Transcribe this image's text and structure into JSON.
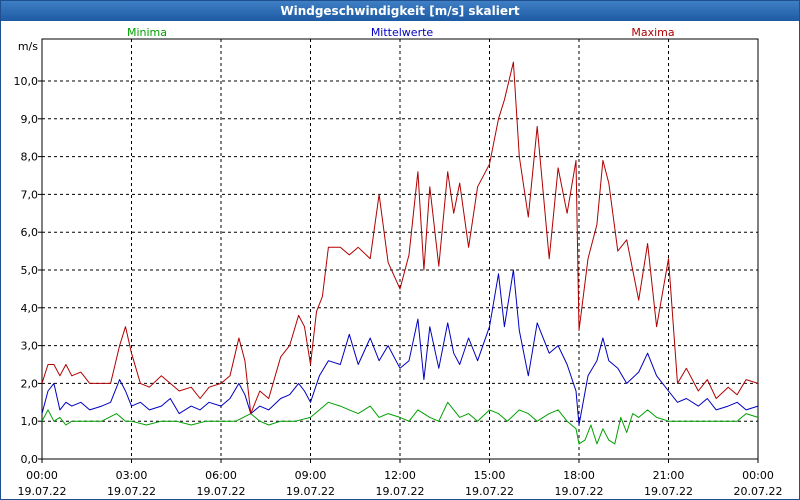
{
  "window": {
    "title": "Windgeschwindigkeit [m/s] skaliert"
  },
  "colors": {
    "min": "#00a000",
    "mean": "#0000c0",
    "max": "#b00000",
    "grid": "#000000"
  },
  "chart_data": {
    "type": "line",
    "title": "Windgeschwindigkeit [m/s] skaliert",
    "ylabel": "m/s",
    "ylim": [
      0,
      11
    ],
    "yticks": [
      0.0,
      1.0,
      2.0,
      3.0,
      4.0,
      5.0,
      6.0,
      7.0,
      8.0,
      9.0,
      10.0
    ],
    "yticklabels": [
      "0,0",
      "1,0",
      "2,0",
      "3,0",
      "4,0",
      "5,0",
      "6,0",
      "7,0",
      "8,0",
      "9,0",
      "10,0"
    ],
    "xlim": [
      0,
      24
    ],
    "xticks": [
      {
        "h": 0,
        "time": "00:00",
        "date": "19.07.22"
      },
      {
        "h": 3,
        "time": "03:00",
        "date": "19.07.22"
      },
      {
        "h": 6,
        "time": "06:00",
        "date": "19.07.22"
      },
      {
        "h": 9,
        "time": "09:00",
        "date": "19.07.22"
      },
      {
        "h": 12,
        "time": "12:00",
        "date": "19.07.22"
      },
      {
        "h": 15,
        "time": "15:00",
        "date": "19.07.22"
      },
      {
        "h": 18,
        "time": "18:00",
        "date": "19.07.22"
      },
      {
        "h": 21,
        "time": "21:00",
        "date": "19.07.22"
      },
      {
        "h": 24,
        "time": "00:00",
        "date": "20.07.22"
      }
    ],
    "grid": true,
    "series": [
      {
        "name": "Minima",
        "key": "min",
        "points": [
          [
            0,
            1.0
          ],
          [
            0.2,
            1.3
          ],
          [
            0.4,
            1.0
          ],
          [
            0.6,
            1.1
          ],
          [
            0.8,
            0.9
          ],
          [
            1.0,
            1.0
          ],
          [
            1.5,
            1.0
          ],
          [
            2.0,
            1.0
          ],
          [
            2.5,
            1.2
          ],
          [
            2.8,
            1.0
          ],
          [
            3.0,
            1.0
          ],
          [
            3.5,
            0.9
          ],
          [
            4.0,
            1.0
          ],
          [
            4.5,
            1.0
          ],
          [
            5.0,
            0.9
          ],
          [
            5.5,
            1.0
          ],
          [
            6.0,
            1.0
          ],
          [
            6.5,
            1.0
          ],
          [
            7.0,
            1.2
          ],
          [
            7.3,
            1.0
          ],
          [
            7.6,
            0.9
          ],
          [
            8.0,
            1.0
          ],
          [
            8.5,
            1.0
          ],
          [
            9.0,
            1.1
          ],
          [
            9.3,
            1.3
          ],
          [
            9.6,
            1.5
          ],
          [
            10.0,
            1.4
          ],
          [
            10.3,
            1.3
          ],
          [
            10.6,
            1.2
          ],
          [
            11.0,
            1.4
          ],
          [
            11.3,
            1.1
          ],
          [
            11.6,
            1.2
          ],
          [
            12.0,
            1.1
          ],
          [
            12.3,
            1.0
          ],
          [
            12.6,
            1.3
          ],
          [
            13.0,
            1.1
          ],
          [
            13.3,
            1.0
          ],
          [
            13.6,
            1.5
          ],
          [
            14.0,
            1.1
          ],
          [
            14.3,
            1.2
          ],
          [
            14.6,
            1.0
          ],
          [
            15.0,
            1.3
          ],
          [
            15.3,
            1.2
          ],
          [
            15.6,
            1.0
          ],
          [
            16.0,
            1.3
          ],
          [
            16.3,
            1.2
          ],
          [
            16.6,
            1.0
          ],
          [
            17.0,
            1.2
          ],
          [
            17.3,
            1.3
          ],
          [
            17.6,
            1.0
          ],
          [
            17.9,
            0.8
          ],
          [
            18.0,
            0.4
          ],
          [
            18.2,
            0.5
          ],
          [
            18.4,
            0.9
          ],
          [
            18.6,
            0.4
          ],
          [
            18.8,
            0.8
          ],
          [
            19.0,
            0.5
          ],
          [
            19.2,
            0.4
          ],
          [
            19.4,
            1.1
          ],
          [
            19.6,
            0.7
          ],
          [
            19.8,
            1.2
          ],
          [
            20.0,
            1.1
          ],
          [
            20.3,
            1.3
          ],
          [
            20.6,
            1.1
          ],
          [
            21.0,
            1.0
          ],
          [
            21.5,
            1.0
          ],
          [
            22.0,
            1.0
          ],
          [
            22.5,
            1.0
          ],
          [
            23.0,
            1.0
          ],
          [
            23.3,
            1.0
          ],
          [
            23.6,
            1.2
          ],
          [
            24.0,
            1.1
          ]
        ]
      },
      {
        "name": "Mittelwerte",
        "key": "mean",
        "points": [
          [
            0,
            1.2
          ],
          [
            0.2,
            1.8
          ],
          [
            0.4,
            2.0
          ],
          [
            0.6,
            1.3
          ],
          [
            0.8,
            1.5
          ],
          [
            1.0,
            1.4
          ],
          [
            1.3,
            1.5
          ],
          [
            1.6,
            1.3
          ],
          [
            2.0,
            1.4
          ],
          [
            2.3,
            1.5
          ],
          [
            2.6,
            2.1
          ],
          [
            2.8,
            1.8
          ],
          [
            3.0,
            1.4
          ],
          [
            3.3,
            1.5
          ],
          [
            3.6,
            1.3
          ],
          [
            4.0,
            1.4
          ],
          [
            4.3,
            1.6
          ],
          [
            4.6,
            1.2
          ],
          [
            5.0,
            1.4
          ],
          [
            5.3,
            1.3
          ],
          [
            5.6,
            1.5
          ],
          [
            6.0,
            1.4
          ],
          [
            6.3,
            1.6
          ],
          [
            6.6,
            2.0
          ],
          [
            6.8,
            1.7
          ],
          [
            7.0,
            1.2
          ],
          [
            7.3,
            1.4
          ],
          [
            7.6,
            1.3
          ],
          [
            8.0,
            1.6
          ],
          [
            8.3,
            1.7
          ],
          [
            8.6,
            2.0
          ],
          [
            8.8,
            1.8
          ],
          [
            9.0,
            1.5
          ],
          [
            9.3,
            2.2
          ],
          [
            9.6,
            2.6
          ],
          [
            10.0,
            2.5
          ],
          [
            10.3,
            3.3
          ],
          [
            10.6,
            2.5
          ],
          [
            11.0,
            3.2
          ],
          [
            11.3,
            2.6
          ],
          [
            11.6,
            3.0
          ],
          [
            12.0,
            2.4
          ],
          [
            12.3,
            2.6
          ],
          [
            12.6,
            3.7
          ],
          [
            12.8,
            2.1
          ],
          [
            13.0,
            3.5
          ],
          [
            13.3,
            2.4
          ],
          [
            13.6,
            3.6
          ],
          [
            13.8,
            2.8
          ],
          [
            14.0,
            2.5
          ],
          [
            14.3,
            3.2
          ],
          [
            14.6,
            2.6
          ],
          [
            15.0,
            3.5
          ],
          [
            15.3,
            4.9
          ],
          [
            15.5,
            3.5
          ],
          [
            15.8,
            5.0
          ],
          [
            16.0,
            3.4
          ],
          [
            16.3,
            2.2
          ],
          [
            16.6,
            3.6
          ],
          [
            17.0,
            2.8
          ],
          [
            17.3,
            3.0
          ],
          [
            17.6,
            2.5
          ],
          [
            17.9,
            1.8
          ],
          [
            18.0,
            0.9
          ],
          [
            18.3,
            2.2
          ],
          [
            18.6,
            2.6
          ],
          [
            18.8,
            3.2
          ],
          [
            19.0,
            2.6
          ],
          [
            19.3,
            2.4
          ],
          [
            19.6,
            2.0
          ],
          [
            20.0,
            2.3
          ],
          [
            20.3,
            2.8
          ],
          [
            20.6,
            2.2
          ],
          [
            21.0,
            1.8
          ],
          [
            21.3,
            1.5
          ],
          [
            21.6,
            1.6
          ],
          [
            22.0,
            1.4
          ],
          [
            22.3,
            1.6
          ],
          [
            22.6,
            1.3
          ],
          [
            23.0,
            1.4
          ],
          [
            23.3,
            1.5
          ],
          [
            23.6,
            1.3
          ],
          [
            24.0,
            1.4
          ]
        ]
      },
      {
        "name": "Maxima",
        "key": "max",
        "points": [
          [
            0,
            2.0
          ],
          [
            0.2,
            2.5
          ],
          [
            0.4,
            2.5
          ],
          [
            0.6,
            2.2
          ],
          [
            0.8,
            2.5
          ],
          [
            1.0,
            2.2
          ],
          [
            1.3,
            2.3
          ],
          [
            1.6,
            2.0
          ],
          [
            2.0,
            2.0
          ],
          [
            2.3,
            2.0
          ],
          [
            2.6,
            3.0
          ],
          [
            2.8,
            3.5
          ],
          [
            3.0,
            2.8
          ],
          [
            3.3,
            2.0
          ],
          [
            3.6,
            1.9
          ],
          [
            4.0,
            2.2
          ],
          [
            4.3,
            2.0
          ],
          [
            4.6,
            1.8
          ],
          [
            5.0,
            1.9
          ],
          [
            5.3,
            1.6
          ],
          [
            5.6,
            1.9
          ],
          [
            6.0,
            2.0
          ],
          [
            6.3,
            2.2
          ],
          [
            6.6,
            3.2
          ],
          [
            6.8,
            2.6
          ],
          [
            7.0,
            1.2
          ],
          [
            7.3,
            1.8
          ],
          [
            7.6,
            1.6
          ],
          [
            8.0,
            2.7
          ],
          [
            8.3,
            3.0
          ],
          [
            8.6,
            3.8
          ],
          [
            8.8,
            3.5
          ],
          [
            9.0,
            2.5
          ],
          [
            9.2,
            3.9
          ],
          [
            9.4,
            4.3
          ],
          [
            9.6,
            5.6
          ],
          [
            10.0,
            5.6
          ],
          [
            10.3,
            5.4
          ],
          [
            10.6,
            5.6
          ],
          [
            11.0,
            5.3
          ],
          [
            11.3,
            7.0
          ],
          [
            11.6,
            5.2
          ],
          [
            12.0,
            4.5
          ],
          [
            12.3,
            5.4
          ],
          [
            12.6,
            7.6
          ],
          [
            12.8,
            5.0
          ],
          [
            13.0,
            7.2
          ],
          [
            13.3,
            5.1
          ],
          [
            13.6,
            7.6
          ],
          [
            13.8,
            6.5
          ],
          [
            14.0,
            7.3
          ],
          [
            14.3,
            5.6
          ],
          [
            14.6,
            7.2
          ],
          [
            15.0,
            7.8
          ],
          [
            15.3,
            9.0
          ],
          [
            15.5,
            9.5
          ],
          [
            15.8,
            10.5
          ],
          [
            16.0,
            8.0
          ],
          [
            16.3,
            6.4
          ],
          [
            16.6,
            8.8
          ],
          [
            17.0,
            5.3
          ],
          [
            17.3,
            7.7
          ],
          [
            17.6,
            6.5
          ],
          [
            17.9,
            7.9
          ],
          [
            18.0,
            3.4
          ],
          [
            18.3,
            5.3
          ],
          [
            18.6,
            6.2
          ],
          [
            18.8,
            7.9
          ],
          [
            19.0,
            7.3
          ],
          [
            19.3,
            5.5
          ],
          [
            19.6,
            5.8
          ],
          [
            20.0,
            4.2
          ],
          [
            20.3,
            5.7
          ],
          [
            20.6,
            3.5
          ],
          [
            21.0,
            5.3
          ],
          [
            21.3,
            2.0
          ],
          [
            21.6,
            2.4
          ],
          [
            22.0,
            1.8
          ],
          [
            22.3,
            2.1
          ],
          [
            22.6,
            1.6
          ],
          [
            23.0,
            1.9
          ],
          [
            23.3,
            1.7
          ],
          [
            23.6,
            2.1
          ],
          [
            24.0,
            2.0
          ]
        ]
      }
    ]
  }
}
